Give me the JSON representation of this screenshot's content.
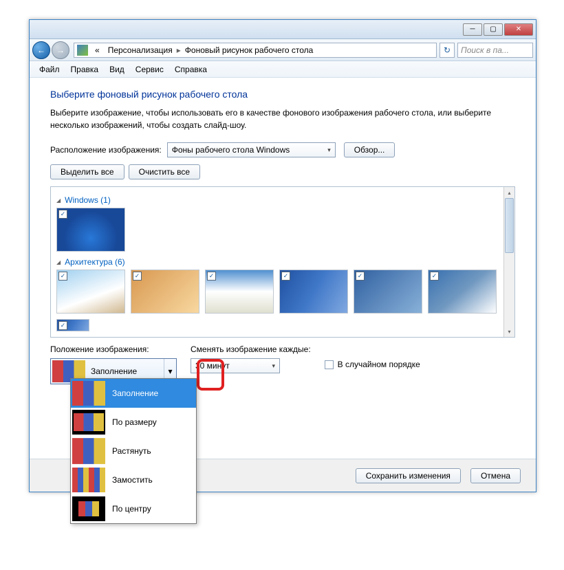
{
  "breadcrumb": {
    "seg1": "Персонализация",
    "seg2": "Фоновый рисунок рабочего стола",
    "prefix": "«"
  },
  "search": {
    "placeholder": "Поиск в па..."
  },
  "menu": {
    "file": "Файл",
    "edit": "Правка",
    "view": "Вид",
    "service": "Сервис",
    "help": "Справка"
  },
  "heading": "Выберите фоновый рисунок рабочего стола",
  "desc": "Выберите изображение, чтобы использовать его в качестве фонового изображения рабочего стола, или выберите несколько изображений, чтобы создать слайд-шоу.",
  "location": {
    "label": "Расположение изображения:",
    "value": "Фоны рабочего стола Windows",
    "browse": "Обзор..."
  },
  "select_all": "Выделить все",
  "clear_all": "Очистить все",
  "groups": {
    "g1": "Windows (1)",
    "g2": "Архитектура (6)"
  },
  "check": "✓",
  "position": {
    "label": "Положение изображения:",
    "value": "Заполнение"
  },
  "interval": {
    "label": "Сменять изображение каждые:",
    "value": "30 минут"
  },
  "shuffle": "В случайном порядке",
  "save": "Сохранить изменения",
  "cancel": "Отмена",
  "dropdown": {
    "fill": "Заполнение",
    "fit": "По размеру",
    "stretch": "Растянуть",
    "tile": "Замостить",
    "center": "По центру"
  },
  "arrows": {
    "down": "▾",
    "left": "←",
    "right": "→",
    "refresh": "↻",
    "dq": "«",
    "tri": "▸"
  }
}
